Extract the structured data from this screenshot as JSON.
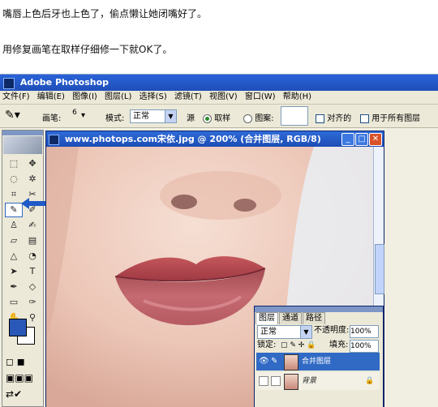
{
  "article": {
    "line1": "嘴唇上色后牙也上色了，偷点懒让她闭嘴好了。",
    "line2": "用修复画笔在取样仔细修一下就OK了。"
  },
  "app": {
    "title": "Adobe Photoshop",
    "menu": [
      "文件(F)",
      "编辑(E)",
      "图像(I)",
      "图层(L)",
      "选择(S)",
      "滤镜(T)",
      "视图(V)",
      "窗口(W)",
      "帮助(H)"
    ]
  },
  "options": {
    "brush_label": "画笔:",
    "brush_size": "6",
    "mode_label": "模式:",
    "mode_value": "正常",
    "source_label": "源",
    "source_sample": "取样",
    "source_pattern": "图案:",
    "aligned": "对齐的",
    "all_layers": "用于所有图层"
  },
  "document": {
    "title": "www.photops.com宋依.jpg @ 200% (合并图层, RGB/8)"
  },
  "layers_panel": {
    "tabs": [
      "图层",
      "通道",
      "路径"
    ],
    "blend_mode": "正常",
    "opacity_label": "不透明度:",
    "opacity_value": "100%",
    "lock_label": "锁定:",
    "fill_label": "填充:",
    "fill_value": "100%",
    "layers": [
      {
        "name": "合并图层",
        "selected": true
      },
      {
        "name": "背景",
        "selected": false
      }
    ]
  },
  "colors": {
    "foreground": "#2a58b8",
    "background": "#ffffff",
    "title_bar": "#1f4fb8",
    "selected_layer": "#316ac5"
  },
  "icons": [
    "healing-brush-icon",
    "move-icon",
    "marquee-icon",
    "lasso-icon",
    "crop-icon",
    "eyedropper-icon",
    "zoom-icon",
    "hand-icon",
    "text-icon",
    "pen-icon"
  ]
}
